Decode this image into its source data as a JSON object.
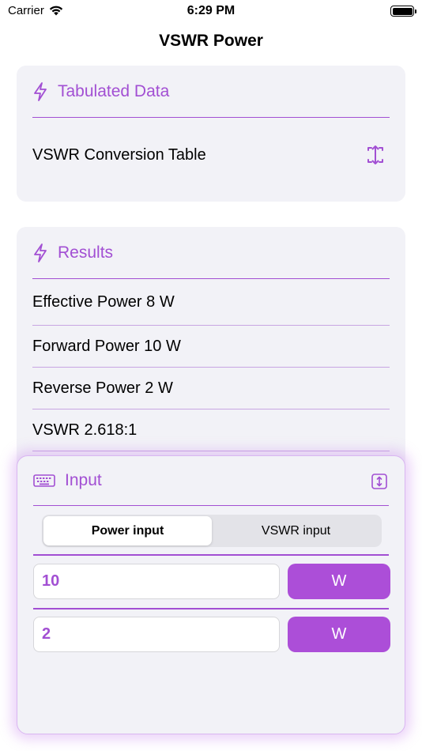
{
  "status_bar": {
    "carrier": "Carrier",
    "time": "6:29 PM"
  },
  "nav": {
    "title": "VSWR Power"
  },
  "tabulated": {
    "header": "Tabulated Data",
    "header_icon": "bolt-icon",
    "row_label": "VSWR Conversion Table",
    "row_icon": "expand-icon"
  },
  "results": {
    "header": "Results",
    "header_icon": "bolt-icon",
    "rows": [
      "Effective Power 8 W",
      "Forward Power 10 W",
      "Reverse Power 2 W",
      "VSWR 2.618:1"
    ]
  },
  "input": {
    "header": "Input",
    "header_icon": "keyboard-icon",
    "resize_icon": "resize-vertical-icon",
    "segments": [
      "Power input",
      "VSWR input"
    ],
    "selected_segment": "Power input",
    "fields": [
      {
        "value": "10",
        "unit": "W"
      },
      {
        "value": "2",
        "unit": "W"
      }
    ]
  },
  "colors": {
    "accent": "#a24fd3",
    "button": "#ac4ed8",
    "card_bg": "#f2f2f7"
  }
}
